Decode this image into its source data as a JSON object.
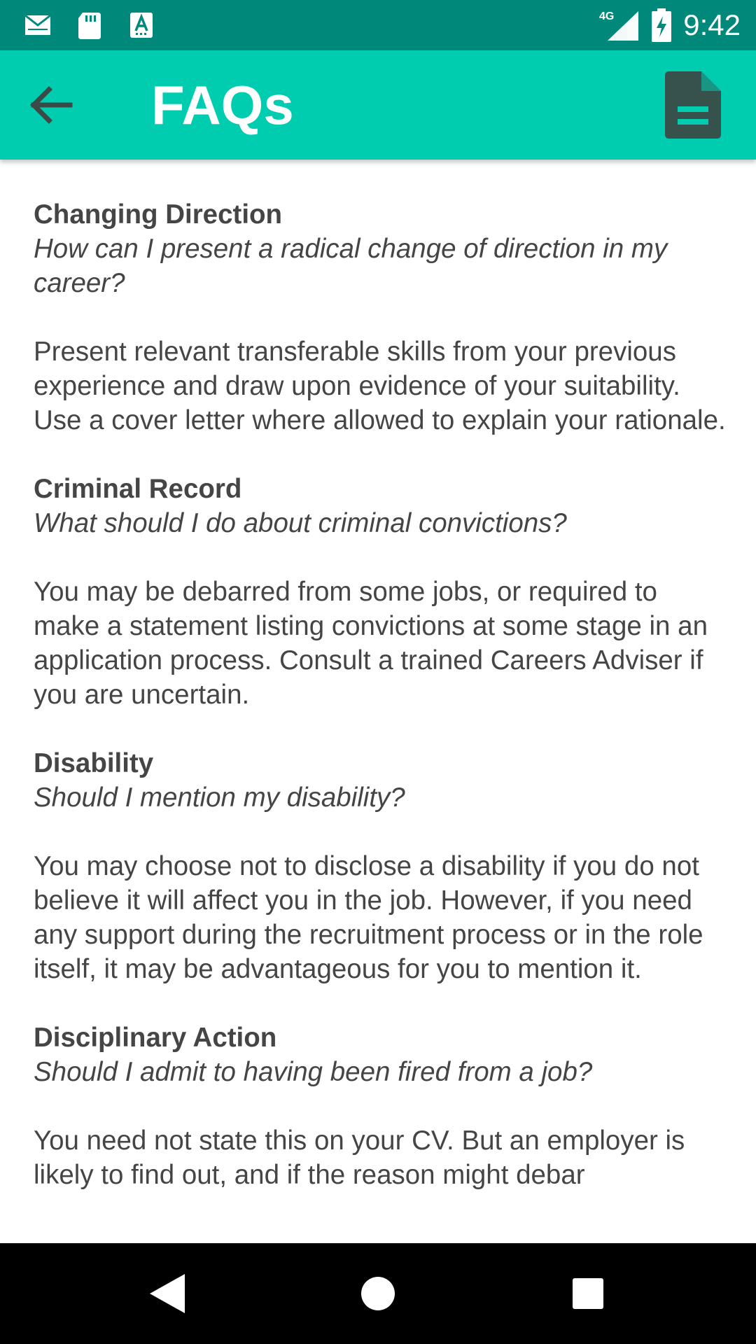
{
  "status_bar": {
    "time": "9:42",
    "network": "4G",
    "left_icons": [
      "mail-icon",
      "sd-card-icon",
      "keyboard-a-icon"
    ],
    "right_icons": [
      "signal-icon",
      "battery-charging-icon"
    ]
  },
  "app_bar": {
    "title": "FAQs",
    "back_icon": "arrow-back-icon",
    "action_icon": "document-icon",
    "color": "#00cdb0"
  },
  "colors": {
    "status_bar": "#00897b",
    "app_bar": "#00cdb0",
    "text": "#454545",
    "nav_bar": "#000000"
  },
  "faqs": [
    {
      "topic": "Changing Direction",
      "question": "How can I present a radical change of direction in my career?",
      "answer": "Present relevant transferable skills from your previous experience and draw upon evidence of your suitability. Use a cover letter where allowed to explain your rationale."
    },
    {
      "topic": "Criminal Record",
      "question": "What should I do about criminal convictions?",
      "answer": "You may be debarred from some jobs, or required to make a statement listing convictions at some stage in an application process. Consult a trained Careers Adviser if you are uncertain."
    },
    {
      "topic": "Disability",
      "question": "Should I mention my disability?",
      "answer": "You may choose not to disclose a disability if you do not believe it will affect you in the job. However, if you need any support during the recruitment process or in the role itself, it may be advantageous for you to mention it."
    },
    {
      "topic": "Disciplinary Action",
      "question": "Should I admit to having been fired from a job?",
      "answer": "You need not state this on your CV. But an employer is likely to find out, and if the reason might debar"
    }
  ],
  "nav_bar": {
    "back_icon": "nav-back-icon",
    "home_icon": "nav-home-icon",
    "recents_icon": "nav-recents-icon"
  }
}
